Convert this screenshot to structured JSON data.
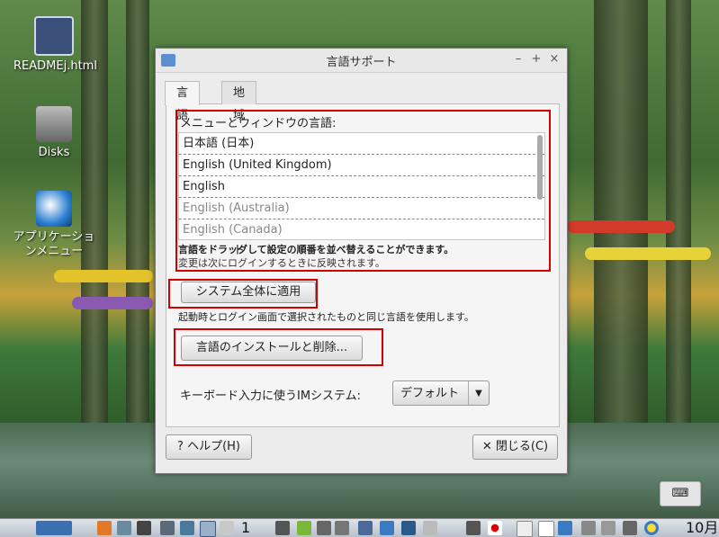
{
  "desktop": {
    "icons": [
      {
        "label": "READMEj.html"
      },
      {
        "label": "Disks"
      },
      {
        "label": "アプリケーションメニュー"
      }
    ]
  },
  "window": {
    "title": "言語サポート",
    "controls": {
      "minimize": "–",
      "maximize": "+",
      "close": "×"
    },
    "tabs": [
      {
        "label": "言語"
      },
      {
        "label": "地域フォーマット"
      }
    ],
    "languages_label": "メニューとウィンドウの言語:",
    "languages": [
      "日本語 (日本)",
      "English (United Kingdom)",
      "English",
      "English (Australia)",
      "English (Canada)"
    ],
    "drag_hint": "言語をドラッグして設定の順番を並べ替えることができます。",
    "relogin_hint": "変更は次にログインするときに反映されます。",
    "apply_system_label": "システム全体に適用",
    "apply_system_desc": "起動時とログイン画面で選択されたものと同じ言語を使用します。",
    "install_remove_label": "言語のインストールと削除...",
    "im_label": "キーボード入力に使うIMシステム:",
    "im_value": "デフォルト",
    "help_label": "ヘルプ(H)",
    "close_label": "閉じる(C)"
  },
  "taskbar": {
    "workspace": "1",
    "clock": "10月"
  },
  "colors": {
    "highlight_box": "#d40000"
  }
}
